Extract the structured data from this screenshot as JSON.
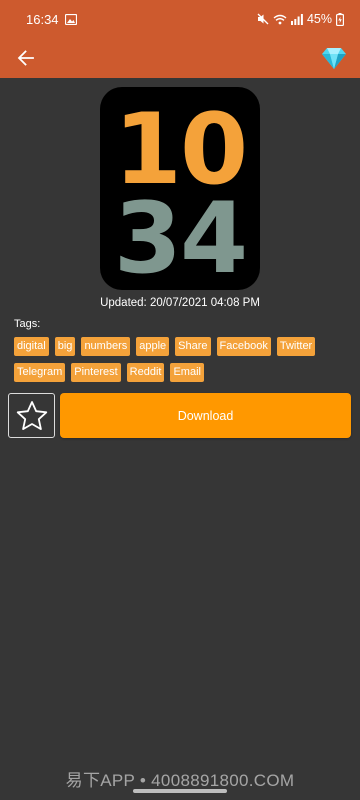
{
  "status_bar": {
    "time": "16:34",
    "battery": "45%"
  },
  "app_bar": {
    "back_icon": "arrow-left-icon",
    "premium_icon": "diamond-icon",
    "accent_color": "#cd5a2e"
  },
  "preview": {
    "hours": "10",
    "minutes": "34",
    "hours_color": "#f4a23a",
    "minutes_color": "#7f978f"
  },
  "updated_text": "Updated: 20/07/2021 04:08 PM",
  "tags_label": "Tags:",
  "tags": [
    "digital",
    "big",
    "numbers",
    "apple",
    "Share",
    "Facebook",
    "Twitter",
    "Telegram",
    "Pinterest",
    "Reddit",
    "Email"
  ],
  "actions": {
    "favorite_icon": "star-outline-icon",
    "download_label": "Download",
    "download_color": "#ff9800"
  },
  "watermark": "易下APP • 4008891800.COM"
}
